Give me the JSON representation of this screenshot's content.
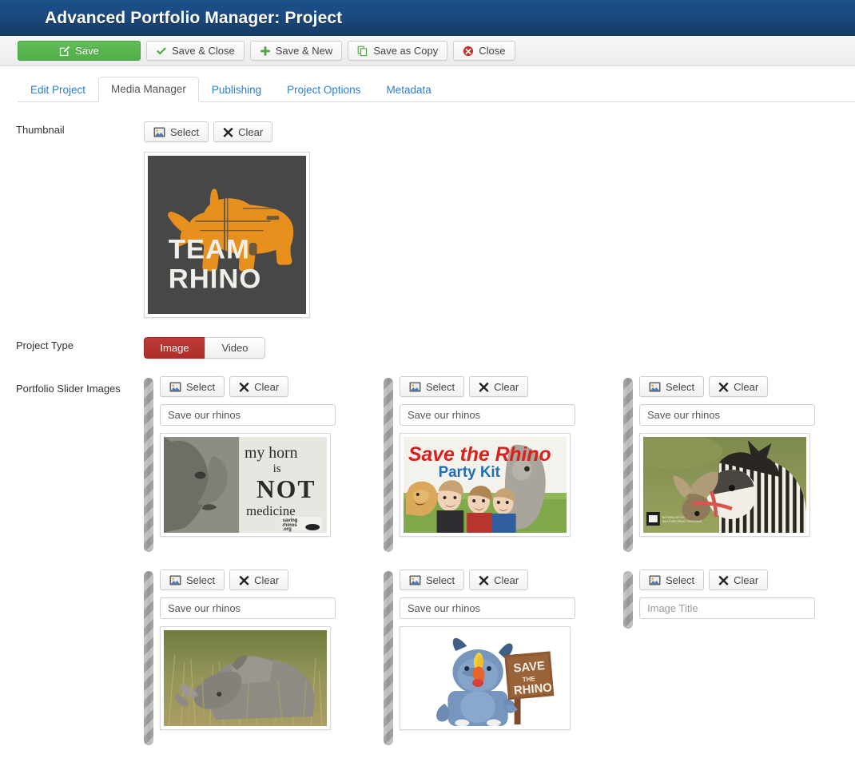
{
  "header": {
    "title": "Advanced Portfolio Manager: Project"
  },
  "toolbar": {
    "buttons": [
      {
        "label": "Save",
        "icon": "edit-pencil-icon",
        "style": "primary"
      },
      {
        "label": "Save & Close",
        "icon": "check-icon",
        "style": "default"
      },
      {
        "label": "Save & New",
        "icon": "plus-icon",
        "style": "default"
      },
      {
        "label": "Save as Copy",
        "icon": "copy-icon",
        "style": "default"
      },
      {
        "label": "Close",
        "icon": "close-circle-icon",
        "style": "default"
      }
    ]
  },
  "tabs": [
    {
      "label": "Edit Project",
      "active": false
    },
    {
      "label": "Media Manager",
      "active": true
    },
    {
      "label": "Publishing",
      "active": false
    },
    {
      "label": "Project Options",
      "active": false
    },
    {
      "label": "Metadata",
      "active": false
    }
  ],
  "thumbnail": {
    "label": "Thumbnail",
    "select_label": "Select",
    "clear_label": "Clear",
    "image_alt": "TEAM RHINO orange rhino graphic on dark grey background",
    "image_text_line1": "TEAM",
    "image_text_line2": "RHINO"
  },
  "project_type": {
    "label": "Project Type",
    "options": [
      "Image",
      "Video"
    ],
    "selected": "Image"
  },
  "slider": {
    "label": "Portfolio Slider Images",
    "select_label": "Select",
    "clear_label": "Clear",
    "title_placeholder": "Image Title",
    "items": [
      {
        "title": "Save our rhinos",
        "image": "rhino-horn-not-medicine",
        "has_image": true
      },
      {
        "title": "Save our rhinos",
        "image": "save-the-rhino-party-kit",
        "has_image": true
      },
      {
        "title": "Save our rhinos",
        "image": "rhino-zebra-photo",
        "has_image": true
      },
      {
        "title": "Save our rhinos",
        "image": "white-rhino-grass-photo",
        "has_image": true
      },
      {
        "title": "Save our rhinos",
        "image": "blue-rhino-vinyl-toy",
        "has_image": true
      },
      {
        "title": "",
        "image": "",
        "has_image": false
      }
    ]
  },
  "colors": {
    "header_top": "#1d5089",
    "header_bottom": "#163a63",
    "primary_green": "#4fae45",
    "accent_red": "#ac2f2b",
    "tab_link": "#2a7fd4"
  }
}
